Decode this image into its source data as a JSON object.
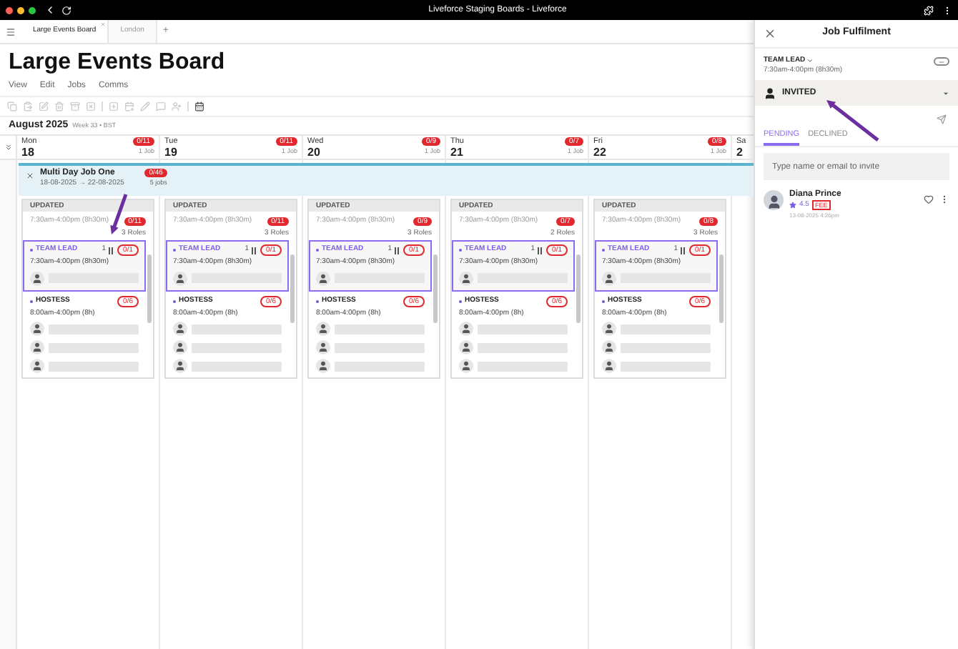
{
  "window": {
    "title": "Liveforce Staging Boards - Liveforce"
  },
  "browser_tabs": [
    {
      "label": "Large Events Board",
      "selected": true
    },
    {
      "label": "London",
      "selected": false
    }
  ],
  "new_tab": "+",
  "board": {
    "title": "Large Events Board",
    "menu": [
      "View",
      "Edit",
      "Jobs",
      "Comms"
    ],
    "month": "August 2025",
    "week": "Week 33 • BST"
  },
  "days": [
    {
      "weekday": "Mon",
      "date": "18",
      "badge": "0/11",
      "jobs": "1 Job"
    },
    {
      "weekday": "Tue",
      "date": "19",
      "badge": "0/11",
      "jobs": "1 Job"
    },
    {
      "weekday": "Wed",
      "date": "20",
      "badge": "0/9",
      "jobs": "1 Job"
    },
    {
      "weekday": "Thu",
      "date": "21",
      "badge": "0/7",
      "jobs": "1 Job"
    },
    {
      "weekday": "Fri",
      "date": "22",
      "badge": "0/8",
      "jobs": "1 Job"
    },
    {
      "weekday": "Sa",
      "date": "2"
    }
  ],
  "job": {
    "title": "Multi Day Job One",
    "dates": "18-08-2025 → 22-08-2025",
    "badge": "0/46",
    "jobs": "5 jobs"
  },
  "cards": [
    {
      "status": "UPDATED",
      "time": "7:30am-4:00pm (8h30m)",
      "badge": "0/11",
      "roles_count": "3 Roles",
      "roles": [
        {
          "name": "TEAM LEAD",
          "count": "1",
          "time": "7:30am-4:00pm (8h30m)",
          "badge": "0/1",
          "selected": true
        },
        {
          "name": "HOSTESS",
          "time": "8:00am-4:00pm (8h)",
          "badge": "0/6",
          "selected": false
        }
      ]
    },
    {
      "status": "UPDATED",
      "time": "7:30am-4:00pm (8h30m)",
      "badge": "0/11",
      "roles_count": "3 Roles",
      "roles": [
        {
          "name": "TEAM LEAD",
          "count": "1",
          "time": "7:30am-4:00pm (8h30m)",
          "badge": "0/1",
          "selected": true
        },
        {
          "name": "HOSTESS",
          "time": "8:00am-4:00pm (8h)",
          "badge": "0/6",
          "selected": false
        }
      ]
    },
    {
      "status": "UPDATED",
      "time": "7:30am-4:00pm (8h30m)",
      "badge": "0/9",
      "roles_count": "3 Roles",
      "roles": [
        {
          "name": "TEAM LEAD",
          "count": "1",
          "time": "7:30am-4:00pm (8h30m)",
          "badge": "0/1",
          "selected": true
        },
        {
          "name": "HOSTESS",
          "time": "8:00am-4:00pm (8h)",
          "badge": "0/6",
          "selected": false
        }
      ]
    },
    {
      "status": "UPDATED",
      "time": "7:30am-4:00pm (8h30m)",
      "badge": "0/7",
      "roles_count": "2 Roles",
      "roles": [
        {
          "name": "TEAM LEAD",
          "count": "1",
          "time": "7:30am-4:00pm (8h30m)",
          "badge": "0/1",
          "selected": true
        },
        {
          "name": "HOSTESS",
          "time": "8:00am-4:00pm (8h)",
          "badge": "0/6",
          "selected": false
        }
      ]
    },
    {
      "status": "UPDATED",
      "time": "7:30am-4:00pm (8h30m)",
      "badge": "0/8",
      "roles_count": "3 Roles",
      "roles": [
        {
          "name": "TEAM LEAD",
          "count": "1",
          "time": "7:30am-4:00pm (8h30m)",
          "badge": "0/1",
          "selected": true
        },
        {
          "name": "HOSTESS",
          "time": "8:00am-4:00pm (8h)",
          "badge": "0/6",
          "selected": false
        }
      ]
    }
  ],
  "panel": {
    "title": "Job Fulfilment",
    "role": "TEAM LEAD",
    "time": "7:30am-4:00pm (8h30m)",
    "status": "INVITED",
    "tabs": [
      {
        "label": "PENDING",
        "selected": true
      },
      {
        "label": "DECLINED",
        "selected": false
      }
    ],
    "search": {
      "placeholder": "Type name or email to invite"
    },
    "people": [
      {
        "name": "Diana Prince",
        "rating": "4.5",
        "tag": "FEE",
        "date": "13-08-2025 4:26pm"
      }
    ]
  }
}
